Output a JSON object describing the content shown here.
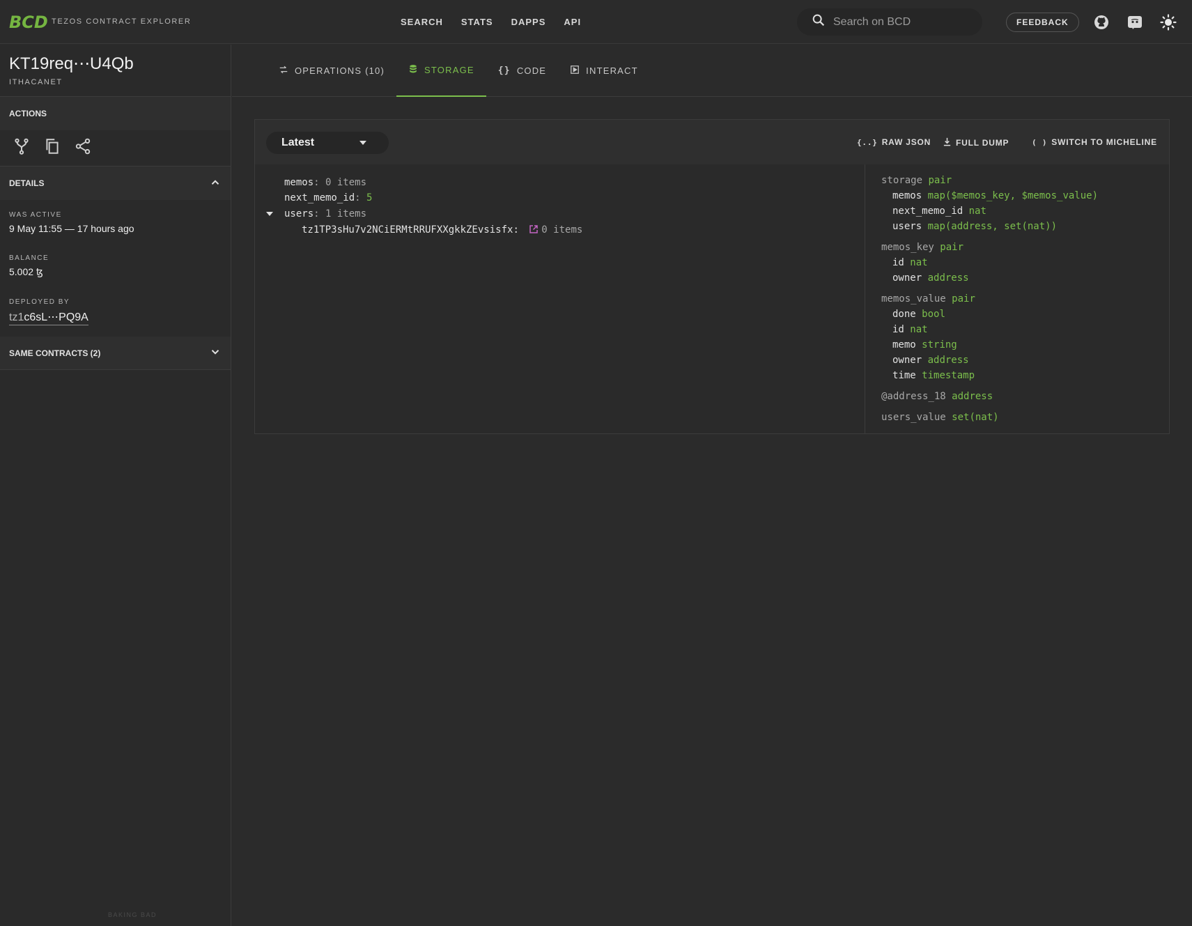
{
  "header": {
    "logo": "BCD",
    "subtitle": "TEZOS CONTRACT EXPLORER",
    "nav": [
      "SEARCH",
      "STATS",
      "DAPPS",
      "API"
    ],
    "search_placeholder": "Search on BCD",
    "feedback": "FEEDBACK",
    "icons": [
      "github-icon",
      "discord-icon",
      "theme-toggle-icon"
    ]
  },
  "sidebar": {
    "contract_id": "KT19req⋯U4Qb",
    "network": "ITHACANET",
    "actions_label": "ACTIONS",
    "action_icons": [
      "fork-icon",
      "copy-icon",
      "share-icon"
    ],
    "details_label": "DETAILS",
    "was_active_label": "WAS ACTIVE",
    "was_active_value": "9 May 11:55 — 17 hours ago",
    "balance_label": "BALANCE",
    "balance_value": "5.002 ꜩ",
    "deployed_by_label": "DEPLOYED BY",
    "deployed_by_prefix": "tz1",
    "deployed_by_value": "c6sL⋯PQ9A",
    "same_contracts_label": "SAME CONTRACTS (2)",
    "footer": "BAKING BAD"
  },
  "tabs": [
    {
      "label": "OPERATIONS (10)",
      "icon": "operations-icon",
      "active": false
    },
    {
      "label": "STORAGE",
      "icon": "database-icon",
      "active": true
    },
    {
      "label": "CODE",
      "icon": "braces-icon",
      "active": false
    },
    {
      "label": "INTERACT",
      "icon": "play-icon",
      "active": false
    }
  ],
  "storage": {
    "version_select": "Latest",
    "raw_json": "RAW JSON",
    "full_dump": "FULL DUMP",
    "switch_micheline": "SWITCH TO MICHELINE",
    "tree": {
      "memos_key": "memos",
      "memos_val": "0 items",
      "next_key": "next_memo_id",
      "next_val": "5",
      "users_key": "users",
      "users_val": "1 items",
      "user_addr": "tz1TP3sHu7v2NCiERMtRRUFXXgkkZEvsisfx",
      "user_val": "0 items"
    },
    "types": {
      "storage": [
        "storage",
        "pair"
      ],
      "memos": [
        "memos",
        "map($memos_key, $memos_value)"
      ],
      "next_memo_id": [
        "next_memo_id",
        "nat"
      ],
      "users": [
        "users",
        "map(address, set(nat))"
      ],
      "memos_key": [
        "memos_key",
        "pair"
      ],
      "mk_id": [
        "id",
        "nat"
      ],
      "mk_owner": [
        "owner",
        "address"
      ],
      "memos_value": [
        "memos_value",
        "pair"
      ],
      "mv_done": [
        "done",
        "bool"
      ],
      "mv_id": [
        "id",
        "nat"
      ],
      "mv_memo": [
        "memo",
        "string"
      ],
      "mv_owner": [
        "owner",
        "address"
      ],
      "mv_time": [
        "time",
        "timestamp"
      ],
      "address_18": [
        "@address_18",
        "address"
      ],
      "users_value": [
        "users_value",
        "set(nat)"
      ]
    }
  }
}
